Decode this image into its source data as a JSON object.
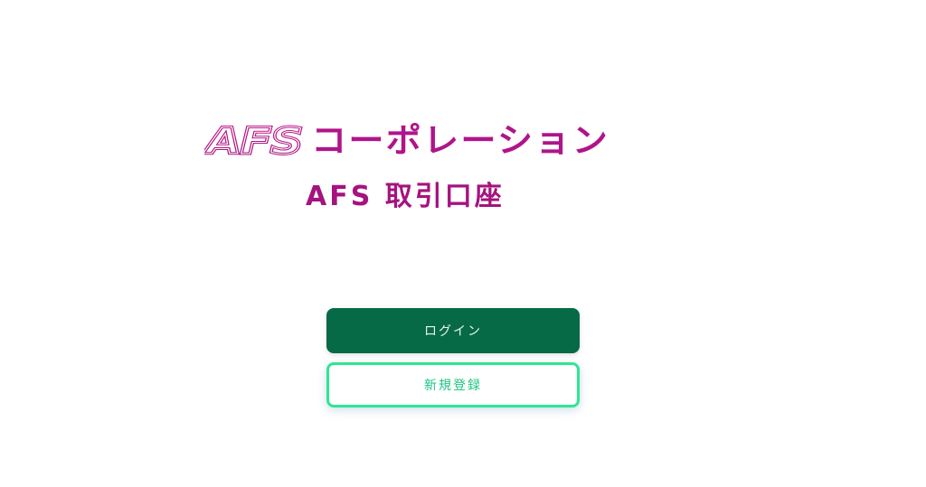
{
  "logo": {
    "mark_text": "AFS",
    "company_name": "コーポレーション",
    "subtitle": "AFS 取引口座"
  },
  "actions": {
    "login_label": "ログイン",
    "register_label": "新規登録"
  },
  "colors": {
    "brand_magenta": "#b0148a",
    "login_bg": "#066a47",
    "register_border": "#2de792",
    "register_text": "#1ec383"
  }
}
